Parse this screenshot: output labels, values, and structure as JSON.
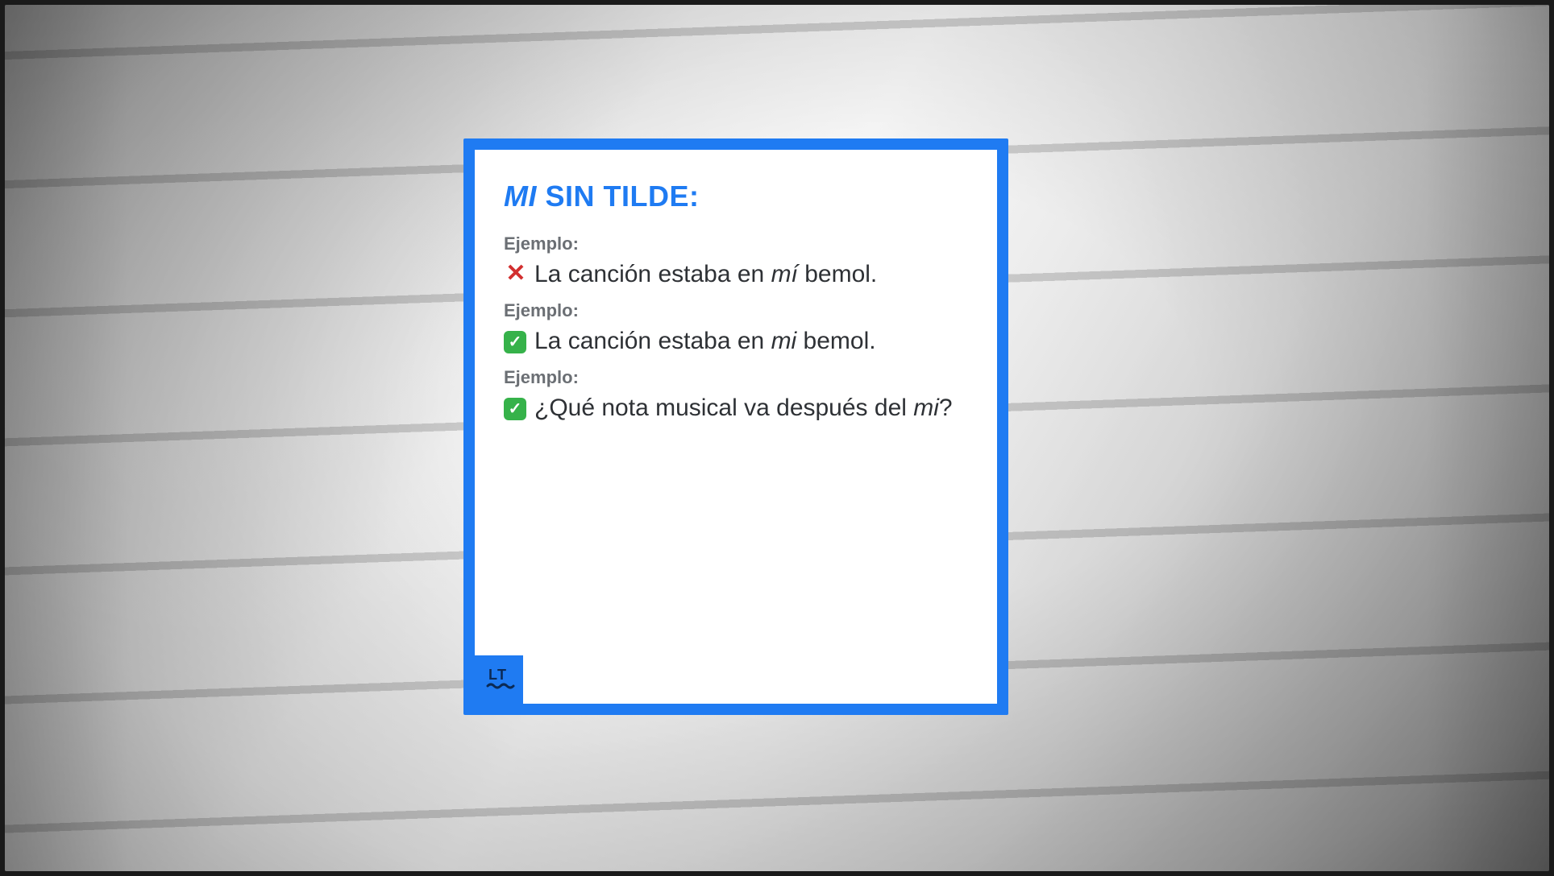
{
  "colors": {
    "accent": "#1f7bf2",
    "good": "#36b24a",
    "bad": "#d22f2f",
    "label": "#6b6f74",
    "text": "#2e3135"
  },
  "card": {
    "title_mi": "MI",
    "title_rest": " SIN TILDE:",
    "label": "Ejemplo:",
    "examples": [
      {
        "status": "bad",
        "pre": "La canción estaba en ",
        "mi": "mí",
        "post": " bemol."
      },
      {
        "status": "good",
        "pre": "La canción estaba en ",
        "mi": "mi",
        "post": " bemol."
      },
      {
        "status": "good",
        "pre": "¿Qué nota musical va después del ",
        "mi": "mi",
        "post": "?"
      }
    ],
    "logo_text": "LT"
  }
}
